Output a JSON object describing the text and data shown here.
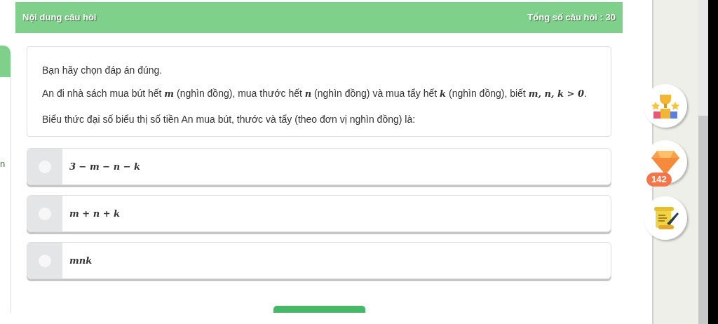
{
  "side_tab_fragment": "n",
  "header": {
    "title": "Nội dung câu hỏi",
    "total": "Tổng số câu hỏi : 30"
  },
  "question": {
    "instruction": "Bạn hãy chọn đáp án đúng.",
    "body": [
      {
        "kind": "text",
        "text": "An đi nhà sách mua bút hết "
      },
      {
        "kind": "math",
        "text": "m"
      },
      {
        "kind": "text",
        "text": " (nghìn đồng), mua thước hết "
      },
      {
        "kind": "math",
        "text": "n"
      },
      {
        "kind": "text",
        "text": " (nghìn đồng) và mua tẩy hết "
      },
      {
        "kind": "math",
        "text": "k"
      },
      {
        "kind": "text",
        "text": " (nghìn đồng), biết "
      },
      {
        "kind": "math",
        "text": "m, n, k > 0"
      },
      {
        "kind": "text",
        "text": ". Biểu thức đại số biểu thị số tiền An mua bút, thước và tẩy (theo đơn vị nghìn đồng) là:"
      }
    ]
  },
  "options": [
    {
      "text": "3 − m − n − k",
      "selected": false
    },
    {
      "text": "m + n + k",
      "selected": false
    },
    {
      "text": "mnk",
      "selected": false
    }
  ],
  "side_tools": [
    {
      "kind": "trophy"
    },
    {
      "kind": "diamond",
      "badge": "142"
    },
    {
      "kind": "scroll"
    }
  ]
}
